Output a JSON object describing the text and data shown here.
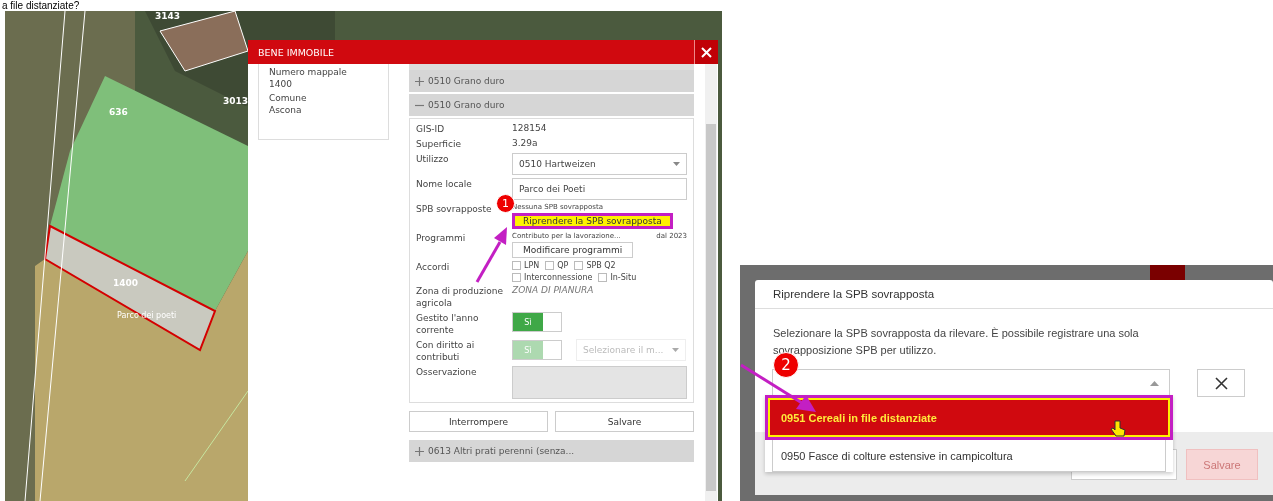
{
  "caption": "a file distanziate?",
  "map": {
    "labels": [
      {
        "text": "3143",
        "kind": "parcel"
      },
      {
        "text": "3013",
        "kind": "parcel"
      },
      {
        "text": "636",
        "kind": "parcel"
      },
      {
        "text": "1400",
        "kind": "parcel"
      },
      {
        "text": "Parco dei poeti",
        "kind": "name"
      }
    ]
  },
  "dialog": {
    "title": "BENE IMMOBILE",
    "parcel": [
      {
        "label": "Numero mappale",
        "value": "1400"
      },
      {
        "label": "Comune",
        "value": "Ascona"
      }
    ],
    "uses_before": [
      {
        "label": "0510 Grano duro",
        "expanded": false
      },
      {
        "label": "0510 Grano duro",
        "expanded": true
      }
    ],
    "form": [
      {
        "kind": "text",
        "label": "GIS-ID",
        "value": "128154"
      },
      {
        "kind": "text",
        "label": "Superficie",
        "value": "3.29a"
      },
      {
        "kind": "select",
        "label": "Utilizzo",
        "value": "0510 Hartweizen"
      },
      {
        "kind": "input",
        "label": "Nome locale",
        "value": "Parco dei Poeti"
      },
      {
        "kind": "spb",
        "label": "SPB sovrapposte",
        "value": "Nessuna SPB sovrapposta",
        "button": "Riprendere la SPB sovrapposta",
        "highlighted": true
      },
      {
        "kind": "programs",
        "label": "Programmi",
        "value": "Contributo per la lavorazione...",
        "since": "dal 2023",
        "button": "Modificare programmi"
      },
      {
        "kind": "checkboxes",
        "label": "Accordi",
        "options": [
          {
            "label": "LPN",
            "checked": false
          },
          {
            "label": "QP",
            "checked": false
          },
          {
            "label": "SPB Q2",
            "checked": false
          },
          {
            "label": "Interconnessione",
            "checked": false
          },
          {
            "label": "In-Situ",
            "checked": false
          }
        ]
      },
      {
        "kind": "zone",
        "label": "Zona di produzione agricola",
        "value": "ZONA DI PIANURA"
      },
      {
        "kind": "toggle",
        "label": "Gestito l'anno corrente",
        "toggle": "Sì",
        "on": true,
        "disabled": false
      },
      {
        "kind": "toggle",
        "label": "Con diritto ai contributi",
        "toggle": "Sì",
        "on": true,
        "disabled": true,
        "placeholder": "Selezionare il m..."
      },
      {
        "kind": "textarea",
        "label": "Osservazione"
      }
    ],
    "buttons": [
      {
        "label": "Interrompere"
      },
      {
        "label": "Salvare"
      }
    ],
    "uses_after": [
      {
        "label": "0613 Altri prati perenni (senza...",
        "expanded": false
      }
    ]
  },
  "popup": {
    "title": "Riprendere la SPB sovrapposta",
    "description": "Selezionare la SPB sovrapposta da rilevare. È possibile registrare una sola sovrapposizione SPB per utilizzo.",
    "options": [
      {
        "label": "0951 Cereali in file distanziate",
        "selected": true
      },
      {
        "label": "0950 Fasce di colture estensive in campicoltura",
        "selected": false
      }
    ],
    "save": {
      "label": "Salvare",
      "disabled": true
    }
  },
  "steps": [
    {
      "number": "1"
    },
    {
      "number": "2"
    }
  ]
}
